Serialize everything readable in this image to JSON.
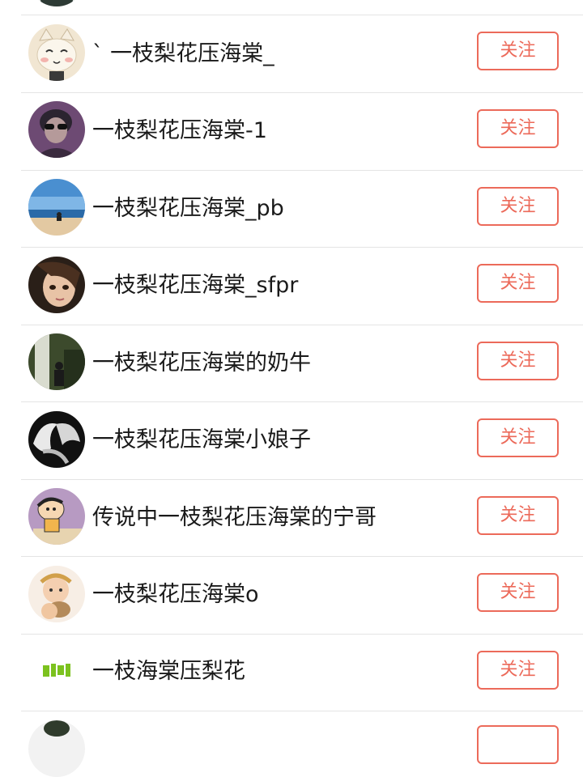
{
  "follow_label": "关注",
  "accent_color": "#ec6a5a",
  "users": [
    {
      "name": "` 一枝梨花压海棠_",
      "avatar_icon": "cat-avatar-icon"
    },
    {
      "name": "一枝梨花压海棠-1",
      "avatar_icon": "person-sunglasses-avatar-icon"
    },
    {
      "name": "一枝梨花压海棠_pb",
      "avatar_icon": "beach-avatar-icon"
    },
    {
      "name": "一枝梨花压海棠_sfpr",
      "avatar_icon": "girl-avatar-icon"
    },
    {
      "name": "一枝梨花压海棠的奶牛",
      "avatar_icon": "waterfall-avatar-icon"
    },
    {
      "name": "一枝梨花压海棠小娘子",
      "avatar_icon": "hands-avatar-icon"
    },
    {
      "name": "传说中一枝梨花压海棠的宁哥",
      "avatar_icon": "cartoon-boy-avatar-icon"
    },
    {
      "name": "一枝梨花压海棠o",
      "avatar_icon": "baby-avatar-icon"
    },
    {
      "name": "一枝海棠压梨花",
      "avatar_icon": "green-text-logo-avatar-icon"
    }
  ]
}
